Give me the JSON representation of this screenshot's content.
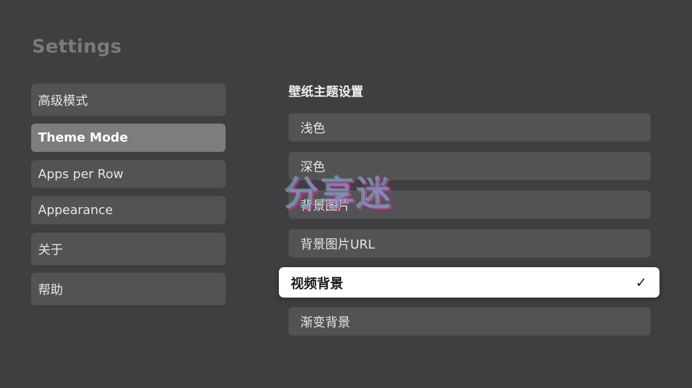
{
  "page": {
    "title": "Settings"
  },
  "sidebar": {
    "items": [
      {
        "label": "高级模式"
      },
      {
        "label": "Theme Mode"
      },
      {
        "label": "Apps per Row"
      },
      {
        "label": "Appearance"
      },
      {
        "label": "关于"
      },
      {
        "label": "帮助"
      }
    ],
    "active_index": 1
  },
  "main": {
    "section_title": "壁纸主题设置",
    "options": [
      {
        "label": "浅色"
      },
      {
        "label": "深色"
      },
      {
        "label": "背景图片"
      },
      {
        "label": "背景图片URL"
      },
      {
        "label": "视频背景",
        "check": "✓"
      },
      {
        "label": "渐变背景"
      }
    ],
    "selected_index": 4
  },
  "watermark": {
    "text": "分享迷"
  },
  "colors": {
    "background": "#3f3f41",
    "item_background": "#535355",
    "active_item_background": "#7d7d7f",
    "selected_option_background": "#ffffff",
    "title_text": "#7a7a7c"
  },
  "icons": {
    "selected_check": "check-icon"
  }
}
